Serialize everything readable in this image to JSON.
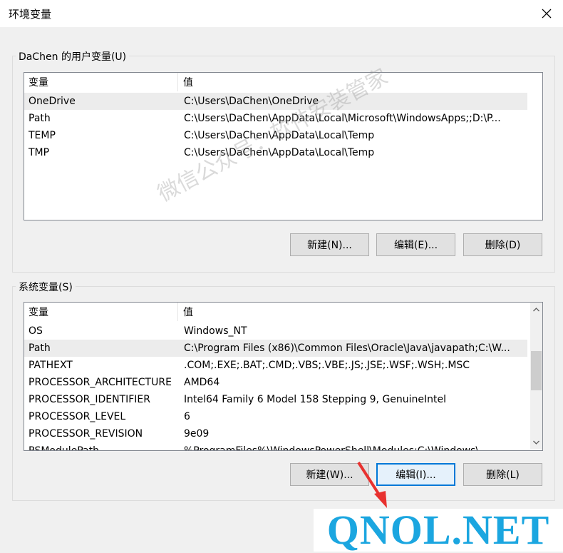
{
  "window": {
    "title": "环境变量",
    "close_icon": "close-icon"
  },
  "user_vars": {
    "legend": "DaChen 的用户变量(U)",
    "header": {
      "col_var": "变量",
      "col_val": "值"
    },
    "rows": [
      {
        "name": "OneDrive",
        "value": "C:\\Users\\DaChen\\OneDrive",
        "selected": true
      },
      {
        "name": "Path",
        "value": "C:\\Users\\DaChen\\AppData\\Local\\Microsoft\\WindowsApps;;D:\\P..."
      },
      {
        "name": "TEMP",
        "value": "C:\\Users\\DaChen\\AppData\\Local\\Temp"
      },
      {
        "name": "TMP",
        "value": "C:\\Users\\DaChen\\AppData\\Local\\Temp"
      }
    ],
    "buttons": {
      "new": "新建(N)...",
      "edit": "编辑(E)...",
      "delete": "删除(D)"
    }
  },
  "system_vars": {
    "legend": "系统变量(S)",
    "header": {
      "col_var": "变量",
      "col_val": "值"
    },
    "rows": [
      {
        "name": "OS",
        "value": "Windows_NT"
      },
      {
        "name": "Path",
        "value": "C:\\Program Files (x86)\\Common Files\\Oracle\\Java\\javapath;C:\\W...",
        "selected": true
      },
      {
        "name": "PATHEXT",
        "value": ".COM;.EXE;.BAT;.CMD;.VBS;.VBE;.JS;.JSE;.WSF;.WSH;.MSC"
      },
      {
        "name": "PROCESSOR_ARCHITECTURE",
        "value": "AMD64"
      },
      {
        "name": "PROCESSOR_IDENTIFIER",
        "value": "Intel64 Family 6 Model 158 Stepping 9, GenuineIntel"
      },
      {
        "name": "PROCESSOR_LEVEL",
        "value": "6"
      },
      {
        "name": "PROCESSOR_REVISION",
        "value": "9e09"
      },
      {
        "name": "PSModulePath",
        "value": "%ProgramFiles%\\WindowsPowerShell\\Modules;C:\\Windows\\..."
      }
    ],
    "buttons": {
      "new": "新建(W)...",
      "edit": "编辑(I)...",
      "delete": "删除(L)"
    }
  },
  "watermark": "微信公众号：软件安装管家",
  "brand": "QNOL.NET",
  "colors": {
    "accent": "#0078d7",
    "arrow": "#e8312f",
    "brand": "#1ba6e0"
  }
}
